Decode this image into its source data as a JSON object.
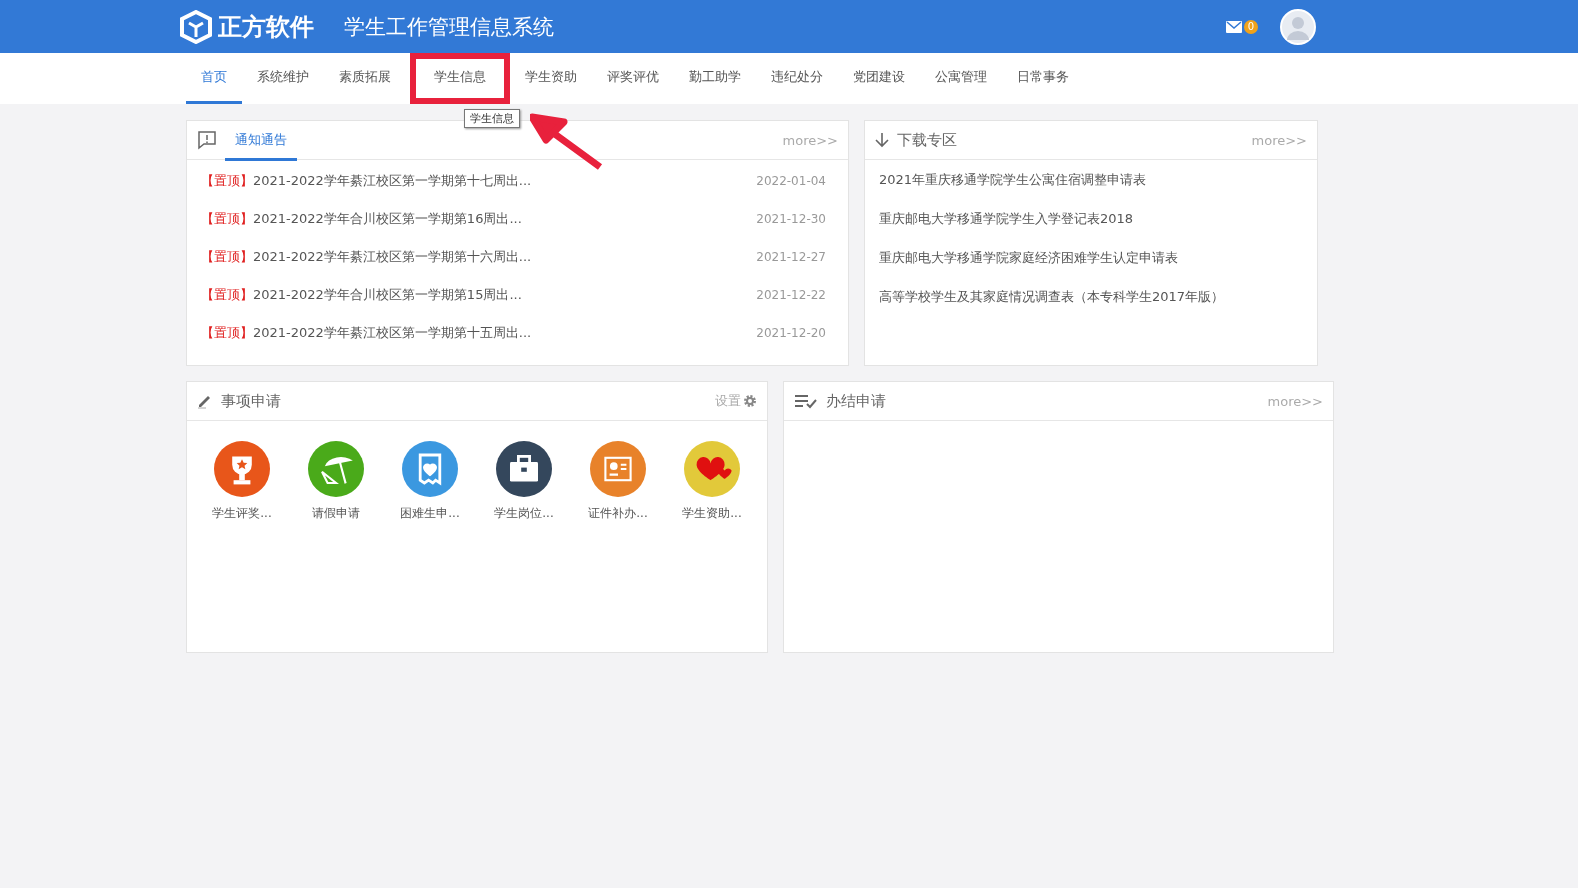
{
  "header": {
    "logo": "正方软件",
    "title": "学生工作管理信息系统",
    "mail_count": "0"
  },
  "nav": [
    {
      "label": "首页",
      "selected": true,
      "marked": false
    },
    {
      "label": "系统维护",
      "selected": false,
      "marked": false
    },
    {
      "label": "素质拓展",
      "selected": false,
      "marked": false
    },
    {
      "label": "学生信息",
      "selected": false,
      "marked": true
    },
    {
      "label": "学生资助",
      "selected": false,
      "marked": false
    },
    {
      "label": "评奖评优",
      "selected": false,
      "marked": false
    },
    {
      "label": "勤工助学",
      "selected": false,
      "marked": false
    },
    {
      "label": "违纪处分",
      "selected": false,
      "marked": false
    },
    {
      "label": "党团建设",
      "selected": false,
      "marked": false
    },
    {
      "label": "公寓管理",
      "selected": false,
      "marked": false
    },
    {
      "label": "日常事务",
      "selected": false,
      "marked": false
    }
  ],
  "tooltip": "学生信息",
  "notices": {
    "tab": "通知通告",
    "more": "more>>",
    "items": [
      {
        "tag": "【置顶】",
        "title": "2021-2022学年綦江校区第一学期第十七周出...",
        "date": "2022-01-04"
      },
      {
        "tag": "【置顶】",
        "title": "2021-2022学年合川校区第一学期第16周出...",
        "date": "2021-12-30"
      },
      {
        "tag": "【置顶】",
        "title": "2021-2022学年綦江校区第一学期第十六周出...",
        "date": "2021-12-27"
      },
      {
        "tag": "【置顶】",
        "title": "2021-2022学年合川校区第一学期第15周出...",
        "date": "2021-12-22"
      },
      {
        "tag": "【置顶】",
        "title": "2021-2022学年綦江校区第一学期第十五周出...",
        "date": "2021-12-20"
      }
    ]
  },
  "downloads": {
    "title": "下载专区",
    "more": "more>>",
    "items": [
      "2021年重庆移通学院学生公寓住宿调整申请表",
      "重庆邮电大学移通学院学生入学登记表2018",
      "重庆邮电大学移通学院家庭经济困难学生认定申请表",
      "高等学校学生及其家庭情况调查表（本专科学生2017年版）"
    ]
  },
  "applications": {
    "title": "事项申请",
    "settings": "设置",
    "items": [
      {
        "label": "学生评奖...",
        "kind": "trophy",
        "color": "#e8561a"
      },
      {
        "label": "请假申请",
        "kind": "umbrella",
        "color": "#4aaa1a"
      },
      {
        "label": "困难生申...",
        "kind": "receipt",
        "color": "#3b98e0"
      },
      {
        "label": "学生岗位...",
        "kind": "briefcase",
        "color": "#34475c"
      },
      {
        "label": "证件补办...",
        "kind": "idcard",
        "color": "#e8822a"
      },
      {
        "label": "学生资助...",
        "kind": "hearts",
        "color": "#e2c93a"
      }
    ]
  },
  "completed": {
    "title": "办结申请",
    "more": "more>>"
  }
}
